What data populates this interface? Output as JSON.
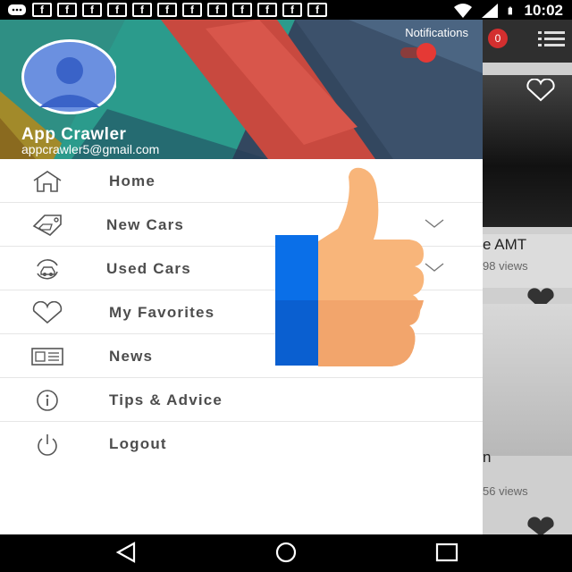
{
  "status_bar": {
    "time": "10:02",
    "left_icons": [
      "message-icon",
      "facebook-icon",
      "facebook-icon",
      "facebook-icon",
      "facebook-icon",
      "facebook-icon",
      "facebook-icon",
      "facebook-icon",
      "facebook-icon",
      "facebook-icon",
      "facebook-icon",
      "facebook-icon",
      "facebook-icon"
    ],
    "right_icons": [
      "wifi-icon",
      "signal-icon",
      "battery-icon"
    ]
  },
  "drawer": {
    "user_name": "App Crawler",
    "user_email": "appcrawler5@gmail.com",
    "notifications_label": "Notifications",
    "notifications_on": true,
    "items": [
      {
        "label": "Home",
        "icon": "home-icon",
        "has_chevron": false
      },
      {
        "label": "New Cars",
        "icon": "car-tag-icon",
        "has_chevron": true
      },
      {
        "label": "Used Cars",
        "icon": "car-refresh-icon",
        "has_chevron": true
      },
      {
        "label": "My Favorites",
        "icon": "heart-icon",
        "has_chevron": false
      },
      {
        "label": "News",
        "icon": "newspaper-icon",
        "has_chevron": false
      },
      {
        "label": "Tips & Advice",
        "icon": "info-icon",
        "has_chevron": false
      },
      {
        "label": "Logout",
        "icon": "power-icon",
        "has_chevron": false
      }
    ]
  },
  "background_app": {
    "badge_count": "0",
    "card1_title": "e AMT",
    "card1_views": "98 views",
    "card2_title": "n",
    "card2_views": "56 views"
  },
  "colors": {
    "accent": "#e53935",
    "drawer_bg": "#ffffff",
    "header_bg": "#2c3e55",
    "thumb_blue": "#0a6fe8",
    "thumb_skin": "#f8b57a"
  },
  "nav_bar": {
    "buttons": [
      "back-icon",
      "home-circle-icon",
      "recents-icon"
    ]
  }
}
